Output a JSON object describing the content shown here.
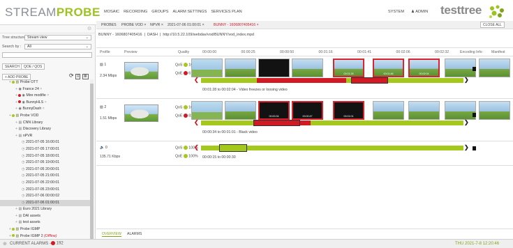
{
  "brand": {
    "name_a": "STREAM",
    "name_b": "PROBE",
    "vendor": "testtree"
  },
  "mainnav": [
    "MOSAIC",
    "RECORDING",
    "GROUPS",
    "ALARM SETTINGS",
    "SERVICES PLAN"
  ],
  "sysnav": {
    "system": "SYSTEM",
    "admin": "ADMIN"
  },
  "leftpanel": {
    "tree_structure_label": "Tree structure :",
    "tree_structure_value": "Stream view",
    "search_by_label": "Search by :",
    "search_by_value": "All",
    "search_button": "SEARCH",
    "qoe_button": "QOE / QOS",
    "add_probe": "+ ADD PROBE",
    "tree": [
      {
        "label": "Probe OTT",
        "indent": 1,
        "icon": "probe",
        "status": "green"
      },
      {
        "label": "France 24",
        "indent": 2,
        "icon": "channel",
        "status": "none"
      },
      {
        "label": "Mire modifie",
        "indent": 2,
        "icon": "channel",
        "status": "red"
      },
      {
        "label": "BunnyHLS",
        "indent": 2,
        "icon": "channel",
        "status": "red"
      },
      {
        "label": "BunnyDash",
        "indent": 2,
        "icon": "channel",
        "status": "none"
      },
      {
        "label": "Probe VOD",
        "indent": 1,
        "icon": "probe",
        "status": "green"
      },
      {
        "label": "CNN Library",
        "indent": 2,
        "icon": "library",
        "status": "none"
      },
      {
        "label": "Discovery Library",
        "indent": 2,
        "icon": "library",
        "status": "none"
      },
      {
        "label": "nPVR",
        "indent": 2,
        "icon": "library",
        "status": "none"
      },
      {
        "label": "2021-07-05 16:00:01",
        "indent": 3,
        "icon": "clock",
        "status": "none"
      },
      {
        "label": "2021-07-05 17:00:01",
        "indent": 3,
        "icon": "clock",
        "status": "none"
      },
      {
        "label": "2021-07-05 18:00:01",
        "indent": 3,
        "icon": "clock",
        "status": "none"
      },
      {
        "label": "2021-07-05 19:00:01",
        "indent": 3,
        "icon": "clock",
        "status": "none"
      },
      {
        "label": "2021-07-05 20:00:01",
        "indent": 3,
        "icon": "clock",
        "status": "none"
      },
      {
        "label": "2021-07-05 21:00:01",
        "indent": 3,
        "icon": "clock",
        "status": "none"
      },
      {
        "label": "2021-07-05 22:00:01",
        "indent": 3,
        "icon": "clock",
        "status": "none"
      },
      {
        "label": "2021-07-05 23:00:01",
        "indent": 3,
        "icon": "clock",
        "status": "none"
      },
      {
        "label": "2021-07-06 00:00:02",
        "indent": 3,
        "icon": "clock",
        "status": "none"
      },
      {
        "label": "2021-07-06 01:00:01",
        "indent": 3,
        "icon": "clock",
        "status": "none",
        "selected": true
      },
      {
        "label": "Euro 2021 Library",
        "indent": 2,
        "icon": "library",
        "status": "none"
      },
      {
        "label": "DAI assets",
        "indent": 2,
        "icon": "library",
        "status": "none"
      },
      {
        "label": "test assets",
        "indent": 2,
        "icon": "library",
        "status": "none"
      },
      {
        "label": "Probe IGMP",
        "indent": 1,
        "icon": "probe",
        "status": "green"
      },
      {
        "label": "Probe IGMP 2",
        "suffix": "(Offline)",
        "indent": 1,
        "icon": "probe",
        "status": "green"
      }
    ]
  },
  "tabs": {
    "items": [
      "PROBES",
      "PROBE VOD",
      "NPVR",
      "2021-07-06 01:00:01",
      "BUNNY - 1606807405416"
    ],
    "close_all": "CLOSE ALL"
  },
  "path": {
    "name": "BUNNY - 1606807405416",
    "type": "DASH",
    "url": "http://10.5.22.109/webdav/vod/BUNNY/vod_index.mpd"
  },
  "columns": {
    "profile": "Profile",
    "preview": "Preview",
    "quality": "Quality",
    "encoding": "Encoding Info",
    "manifest": "Manifest"
  },
  "timeline_ticks": [
    "00:00:00",
    "00:00:25",
    "00:00:50",
    "00:01:16",
    "00:01:41",
    "00:02:06",
    "00:02:32"
  ],
  "rows": [
    {
      "id": "1",
      "bitrate": "2.34 Mbps",
      "qos_label": "QoS",
      "qos_value": "100%",
      "qoe_label": "QoE",
      "qoe_value": "61%",
      "qoe_color": "#d01b25",
      "note": "00:01:28 to 00:02:04 - Video freezes or loosing video",
      "frame_times": [
        "",
        "",
        "",
        "",
        "00:01:28",
        "00:01:46",
        "00:02:04",
        "",
        ""
      ]
    },
    {
      "id": "2",
      "bitrate": "1.51 Mbps",
      "qos_label": "QoS",
      "qos_value": "100%",
      "qoe_label": "QoE",
      "qoe_value": "82%",
      "qoe_color": "#d01b25",
      "note": "00:00:34 to 00:01:01 - Black video",
      "frame_times": [
        "",
        "",
        "00:00:34",
        "00:00:47",
        "00:01:01",
        "",
        "",
        "",
        ""
      ]
    },
    {
      "id": "0",
      "bitrate": "135.71 Kbps",
      "qos_label": "QoS",
      "qos_value": "100%",
      "qoe_label": "QoE",
      "qoe_value": "100%",
      "qoe_color": "#a5c81c",
      "note": "00:00:15 to 00:00:30",
      "frame_times": []
    }
  ],
  "bottomtabs": {
    "overview": "OVERVIEW",
    "alarms": "ALARMS"
  },
  "status": {
    "alarms_label": "CURRENT ALARMS -",
    "alarm_count": "192",
    "datetime": "THU 2021-7-8 12:20:46"
  }
}
